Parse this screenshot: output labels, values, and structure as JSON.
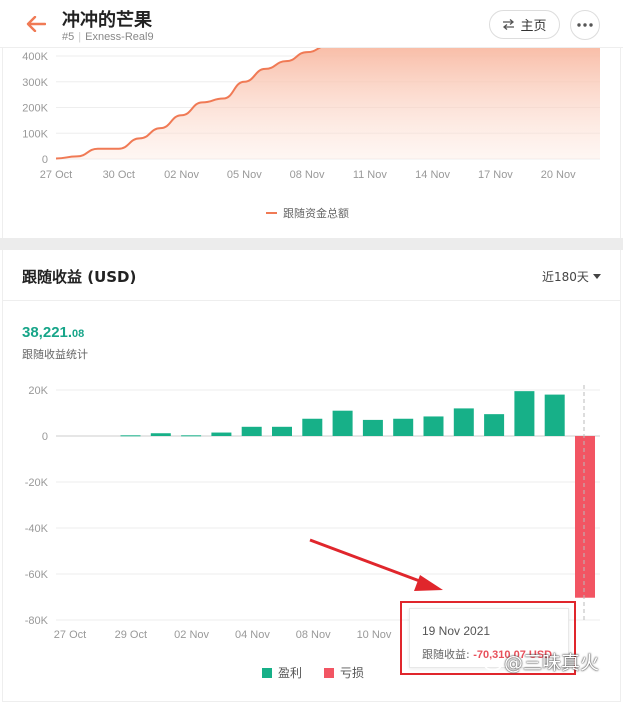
{
  "header": {
    "title": "冲冲的芒果",
    "rank": "#5",
    "account": "Exness-Real9",
    "home_label": "主页"
  },
  "section": {
    "title": "跟随收益 (USD)",
    "range": "近180天",
    "total_int": "38,221.",
    "total_dec": "08",
    "total_label": "跟随收益统计"
  },
  "tooltip": {
    "date": "19 Nov 2021",
    "label": "跟随收益:",
    "value": "-70,310.07 USD"
  },
  "watermark": "@三味真火",
  "colors": {
    "accent": "#f07a55",
    "profit": "#17b088",
    "loss": "#f25563",
    "highlight": "#e0262c"
  },
  "chart_data": [
    {
      "type": "area",
      "series": [
        {
          "name": "跟随资金总额",
          "x": [
            "27 Oct",
            "28 Oct",
            "29 Oct",
            "30 Oct",
            "31 Oct",
            "01 Nov",
            "02 Nov",
            "03 Nov",
            "04 Nov",
            "05 Nov",
            "06 Nov",
            "07 Nov",
            "08 Nov",
            "09 Nov"
          ],
          "values": [
            2000,
            10000,
            40000,
            40000,
            80000,
            120000,
            170000,
            220000,
            235000,
            300000,
            350000,
            380000,
            415000,
            440000
          ]
        }
      ],
      "xticks": [
        "27 Oct",
        "30 Oct",
        "02 Nov",
        "05 Nov",
        "08 Nov",
        "11 Nov",
        "14 Nov",
        "17 Nov",
        "20 Nov"
      ],
      "yticks": [
        "400K",
        "300K",
        "200K",
        "100K",
        "0"
      ],
      "legend_label": "跟随资金总额",
      "legend_position": "bottom",
      "grid": true
    },
    {
      "type": "bar",
      "categories": [
        "28 Oct",
        "29 Oct",
        "30 Oct",
        "31 Oct",
        "01 Nov",
        "02 Nov",
        "03 Nov",
        "04 Nov",
        "05 Nov",
        "06 Nov",
        "07 Nov",
        "08 Nov",
        "09 Nov",
        "10 Nov",
        "11 Nov",
        "12 Nov",
        "13 Nov",
        "14 Nov",
        "15 Nov",
        "16 Nov",
        "17 Nov",
        "18 Nov",
        "19 Nov"
      ],
      "values": [
        0,
        0,
        0,
        300,
        1200,
        300,
        1500,
        4000,
        4000,
        7500,
        11000,
        7000,
        7500,
        8500,
        12000,
        9500,
        19500,
        18000,
        -70310.07
      ],
      "xticks": [
        "27 Oct",
        "29 Oct",
        "02 Nov",
        "04 Nov",
        "08 Nov",
        "10 Nov"
      ],
      "yticks": [
        "20K",
        "0",
        "-20K",
        "-40K",
        "-60K",
        "-80K"
      ],
      "ylim": [
        -80000,
        20000
      ],
      "legend": [
        {
          "name": "盈利",
          "color": "#17b088"
        },
        {
          "name": "亏损",
          "color": "#f25563"
        }
      ],
      "legend_position": "bottom",
      "grid": true
    }
  ]
}
